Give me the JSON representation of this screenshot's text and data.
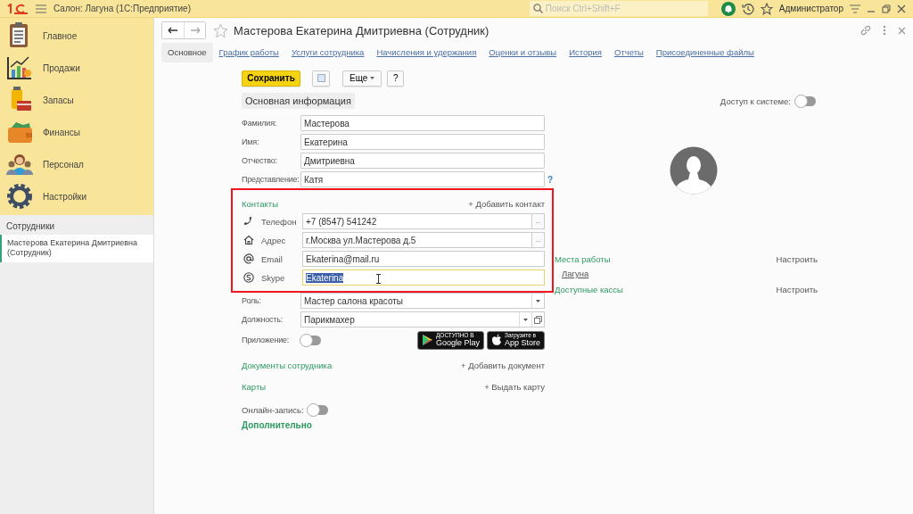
{
  "app_bar": {
    "title": "Салон: Лагуна  (1С:Предприятие)",
    "search": {
      "placeholder": "Поиск Ctrl+Shift+F"
    },
    "user": "Администратор"
  },
  "sidebar": {
    "sections": [
      {
        "label": "Главное"
      },
      {
        "label": "Продажи"
      },
      {
        "label": "Запасы"
      },
      {
        "label": "Финансы"
      },
      {
        "label": "Персонал"
      },
      {
        "label": "Настройки"
      }
    ],
    "open_windows_title": "Сотрудники",
    "open_windows": [
      {
        "label": "Мастерова Екатерина Дмитриевна (Сотрудник)",
        "selected": true
      }
    ]
  },
  "form": {
    "title": "Мастерова Екатерина Дмитриевна (Сотрудник)",
    "tabs": [
      {
        "label": "Основное",
        "selected": true
      },
      {
        "label": "График работы",
        "selected": false
      },
      {
        "label": "Услуги сотрудника",
        "selected": false
      },
      {
        "label": "Начисления и удержания",
        "selected": false
      },
      {
        "label": "Оценки и отзывы",
        "selected": false
      },
      {
        "label": "История",
        "selected": false
      },
      {
        "label": "Отчеты",
        "selected": false
      },
      {
        "label": "Присоединенные файлы",
        "selected": false
      }
    ],
    "toolbar": {
      "save": "Сохранить",
      "more": "Еще",
      "help": "?"
    },
    "section_title": "Основная информация",
    "system_access": {
      "label": "Доступ к системе:",
      "on": false
    },
    "name_fields": [
      {
        "label": "Фамилия:",
        "value": "Мастерова"
      },
      {
        "label": "Имя:",
        "value": "Екатерина"
      },
      {
        "label": "Отчество:",
        "value": "Дмитриевна"
      },
      {
        "label": "Представление:",
        "value": "Катя",
        "help": "?"
      }
    ],
    "contacts": {
      "title": "Контакты",
      "add": "+ Добавить контакт",
      "highlighted": true,
      "items": [
        {
          "label": "Телефон",
          "value": "+7 (8547) 541242",
          "picker": "...",
          "focused": false,
          "text_selected": false
        },
        {
          "label": "Адрес",
          "value": "г.Москва ул.Мастерова д.5",
          "picker": "...",
          "focused": false,
          "text_selected": false
        },
        {
          "label": "Email",
          "value": "Ekaterina@mail.ru",
          "focused": false,
          "text_selected": false
        },
        {
          "label": "Skype",
          "value": "Ekaterina",
          "focused": true,
          "text_selected": true
        }
      ]
    },
    "selects": [
      {
        "label": "Роль:",
        "value": "Мастер салона красоты",
        "open_button": false
      },
      {
        "label": "Должность:",
        "value": "Парикмахер",
        "open_button": true
      }
    ],
    "app": {
      "label": "Приложение:",
      "on": false,
      "stores": [
        {
          "kind": "google",
          "small": "ДОСТУПНО В",
          "name": "Google Play"
        },
        {
          "kind": "apple",
          "small": "Загрузите в",
          "name": "App Store"
        }
      ]
    },
    "link_sections": [
      {
        "title": "Документы сотрудника",
        "action": "+ Добавить документ"
      },
      {
        "title": "Карты",
        "action": "+ Выдать карту"
      }
    ],
    "online_booking": {
      "label": "Онлайн-запись:",
      "on": false
    },
    "more_section": "Дополнительно",
    "workplaces": {
      "title": "Места работы",
      "action": "Настроить",
      "items": [
        "Лагуна"
      ]
    },
    "cash_desks": {
      "title": "Доступные кассы",
      "action": "Настроить"
    }
  }
}
